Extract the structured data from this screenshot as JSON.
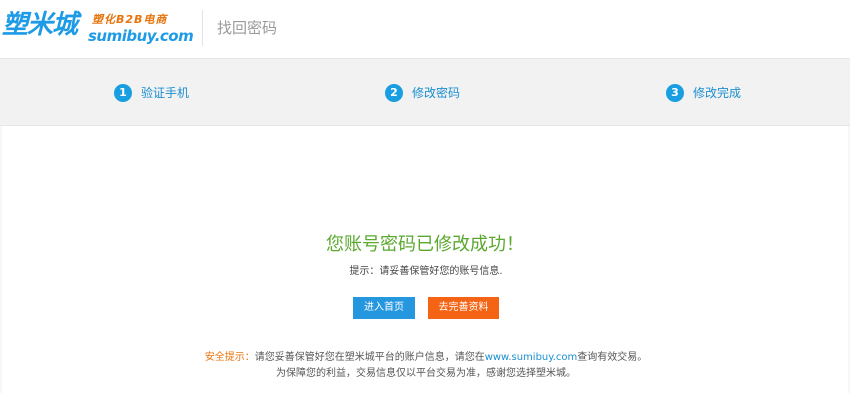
{
  "header": {
    "logo_cn": "塑米城",
    "logo_sub": "塑化B2B电商",
    "logo_domain": "sumibuy.com",
    "page_title": "找回密码"
  },
  "steps": [
    {
      "number": "1",
      "label": "验证手机"
    },
    {
      "number": "2",
      "label": "修改密码"
    },
    {
      "number": "3",
      "label": "修改完成"
    }
  ],
  "main": {
    "success_title": "您账号密码已修改成功！",
    "hint": "提示：请妥善保管好您的账号信息.",
    "home_button": "进入首页",
    "complete_profile_button": "去完善资料"
  },
  "notice": {
    "label": "安全提示：",
    "line1_before": "请您妥善保管好您在塑米城平台的账户信息，请您在",
    "link": "www.sumibuy.com",
    "line1_after": "查询有效交易。",
    "line2": "为保障您的利益，交易信息仅以平台交易为准，感谢您选择塑米城。"
  },
  "colors": {
    "brand_blue": "#1e9be6",
    "brand_orange": "#e8730c",
    "success_green": "#5aa82e",
    "home_button": "#2597df",
    "complete_button": "#f56415"
  }
}
